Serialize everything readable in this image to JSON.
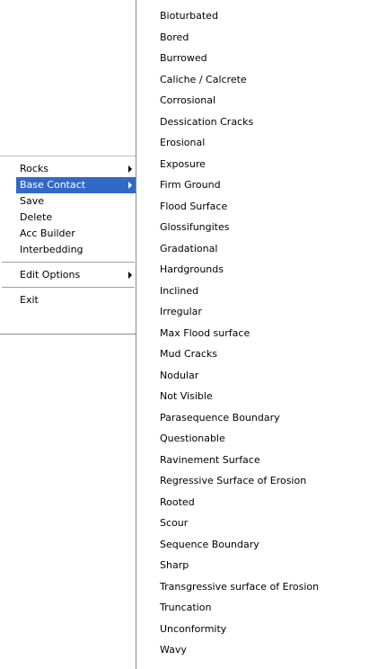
{
  "main_menu": {
    "items": [
      {
        "label": "Rocks",
        "submenu": true,
        "highlighted": false
      },
      {
        "label": "Base Contact",
        "submenu": true,
        "highlighted": true
      },
      {
        "label": "Save",
        "submenu": false,
        "highlighted": false
      },
      {
        "label": "Delete",
        "submenu": false,
        "highlighted": false
      },
      {
        "label": "Acc Builder",
        "submenu": false,
        "highlighted": false
      },
      {
        "label": "Interbedding",
        "submenu": false,
        "highlighted": false
      },
      {
        "label": "Edit Options",
        "submenu": true,
        "highlighted": false
      },
      {
        "label": "Exit",
        "submenu": false,
        "highlighted": false
      }
    ],
    "highlight_color": "#316ac5"
  },
  "sub_menu": {
    "items": [
      "Bioturbated",
      "Bored",
      "Burrowed",
      "Caliche / Calcrete",
      "Corrosional",
      "Dessication Cracks",
      "Erosional",
      "Exposure",
      "Firm Ground",
      "Flood Surface",
      "Glossifungites",
      "Gradational",
      "Hardgrounds",
      "Inclined",
      "Irregular",
      "Max Flood surface",
      "Mud Cracks",
      "Nodular",
      "Not Visible",
      "Parasequence Boundary",
      "Questionable",
      "Ravinement Surface",
      "Regressive Surface of Erosion",
      "Rooted",
      "Scour",
      "Sequence Boundary",
      "Sharp",
      "Transgressive surface of Erosion",
      "Truncation",
      "Unconformity",
      "Wavy"
    ]
  }
}
